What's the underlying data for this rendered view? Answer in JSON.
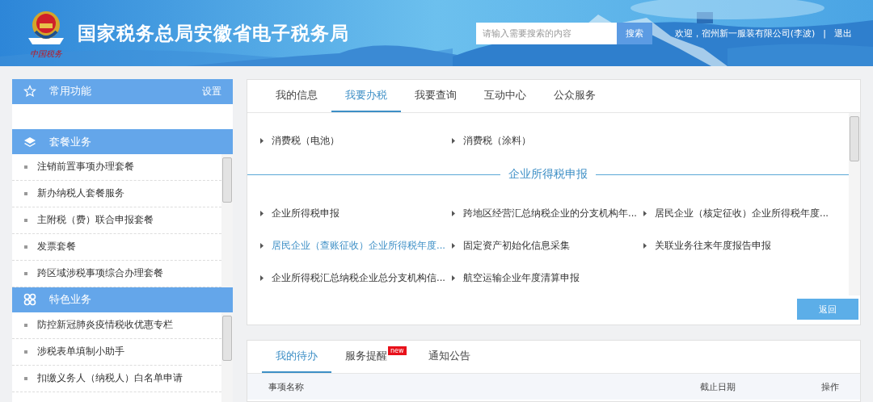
{
  "header": {
    "title": "国家税务总局安徽省电子税务局",
    "logo_caption": "中国税务",
    "search": {
      "placeholder": "请输入需要搜索的内容",
      "button": "搜索"
    },
    "welcome": "欢迎，宿州新一服装有限公司(李波)",
    "separator": "|",
    "logout": "退出"
  },
  "sidebar": {
    "sections": [
      {
        "title": "常用功能",
        "action": "设置"
      },
      {
        "title": "套餐业务",
        "scrollable": true,
        "items": [
          "注销前置事项办理套餐",
          "新办纳税人套餐服务",
          "主附税（费）联合申报套餐",
          "发票套餐",
          "跨区域涉税事项综合办理套餐"
        ]
      },
      {
        "title": "特色业务",
        "scrollable": true,
        "items": [
          "防控新冠肺炎疫情税收优惠专栏",
          "涉税表单填制小助手",
          "扣缴义务人（纳税人）白名单申请"
        ]
      }
    ]
  },
  "main_panel": {
    "tabs": [
      {
        "label": "我的信息",
        "selected": false
      },
      {
        "label": "我要办税",
        "selected": true
      },
      {
        "label": "我要查询",
        "selected": false
      },
      {
        "label": "互动中心",
        "selected": false
      },
      {
        "label": "公众服务",
        "selected": false
      }
    ],
    "groups": [
      {
        "items": [
          {
            "label": "消费税（电池）",
            "highlighted": false
          },
          {
            "label": "消费税（涂料）",
            "highlighted": false
          }
        ]
      },
      {
        "title": "企业所得税申报",
        "items": [
          {
            "label": "企业所得税申报",
            "highlighted": false
          },
          {
            "label": "跨地区经营汇总纳税企业的分支机构年...",
            "highlighted": false
          },
          {
            "label": "居民企业（核定征收）企业所得税年度...",
            "highlighted": false
          },
          {
            "label": "居民企业（查账征收）企业所得税年度...",
            "highlighted": true
          },
          {
            "label": "固定资产初始化信息采集",
            "highlighted": false
          },
          {
            "label": "关联业务往来年度报告申报",
            "highlighted": false
          },
          {
            "label": "企业所得税汇总纳税企业总分支机构信...",
            "highlighted": false
          },
          {
            "label": "航空运输企业年度清算申报",
            "highlighted": false
          }
        ]
      }
    ],
    "button": "返回"
  },
  "todo_panel": {
    "tabs": [
      {
        "label": "我的待办",
        "selected": true
      },
      {
        "label": "服务提醒",
        "selected": false,
        "badge": "new"
      },
      {
        "label": "通知公告",
        "selected": false
      }
    ],
    "columns": [
      "事项名称",
      "截止日期",
      "操作"
    ]
  }
}
